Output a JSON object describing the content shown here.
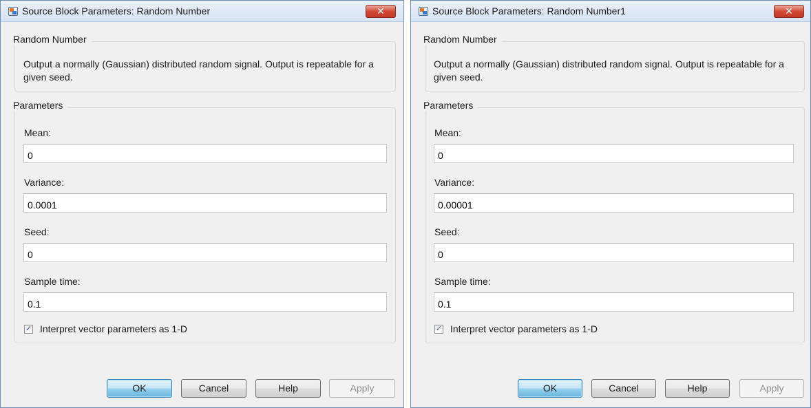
{
  "dialogs": [
    {
      "title": "Source Block Parameters: Random Number",
      "close_glyph": "✕",
      "block_name": "Random Number",
      "description": "Output a normally (Gaussian) distributed random signal.  Output is repeatable for a given seed.",
      "params_label": "Parameters",
      "fields": [
        {
          "label": "Mean:",
          "value": "0"
        },
        {
          "label": "Variance:",
          "value": "0.0001"
        },
        {
          "label": "Seed:",
          "value": "0"
        },
        {
          "label": "Sample time:",
          "value": "0.1"
        }
      ],
      "checkbox": {
        "label": "Interpret vector parameters as 1-D",
        "checked": true,
        "glyph": "✓"
      },
      "buttons": {
        "ok": "OK",
        "cancel": "Cancel",
        "help": "Help",
        "apply": "Apply"
      }
    },
    {
      "title": "Source Block Parameters: Random Number1",
      "close_glyph": "✕",
      "block_name": "Random Number",
      "description": "Output a normally (Gaussian) distributed random signal.  Output is repeatable for a given seed.",
      "params_label": "Parameters",
      "fields": [
        {
          "label": "Mean:",
          "value": "0"
        },
        {
          "label": "Variance:",
          "value": "0.00001"
        },
        {
          "label": "Seed:",
          "value": "0"
        },
        {
          "label": "Sample time:",
          "value": "0.1"
        }
      ],
      "checkbox": {
        "label": "Interpret vector parameters as 1-D",
        "checked": true,
        "glyph": "✓"
      },
      "buttons": {
        "ok": "OK",
        "cancel": "Cancel",
        "help": "Help",
        "apply": "Apply"
      }
    }
  ],
  "icons": {
    "app": "simulink-block-icon",
    "close": "close-icon",
    "check": "checkbox-check-icon"
  },
  "colors": {
    "close_button": "#c13a27",
    "ok_button": "#98d1ef",
    "window_bg": "#f0f0f0"
  }
}
